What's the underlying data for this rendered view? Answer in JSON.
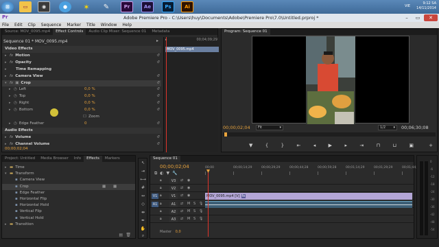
{
  "taskbar": {
    "apps": [
      "Pr",
      "Ae",
      "Ps",
      "Ai"
    ],
    "tray_lang": "VIE",
    "tray_time": "9:12 SA",
    "tray_date": "14/11/2014"
  },
  "window": {
    "title": "Adobe Premiere Pro - C:\\Users\\huy\\Documents\\Adobe\\Premiere Pro\\7.0\\Untitled.prproj *"
  },
  "menu": [
    "File",
    "Edit",
    "Clip",
    "Sequence",
    "Marker",
    "Title",
    "Window",
    "Help"
  ],
  "source_panel": {
    "tabs": [
      "Source: MOV_0095.mp4",
      "Effect Controls",
      "Audio Clip Mixer: Sequence 01",
      "Metadata"
    ],
    "clip_label": "Sequence 01 * MOV_0095.mp4",
    "ruler_time": "00;04;09;29",
    "clip_bar": "MOV_0095.mp4",
    "rows": [
      {
        "name": "Video Effects",
        "kind": "section"
      },
      {
        "name": "Motion",
        "kind": "fx"
      },
      {
        "name": "Opacity",
        "kind": "fx"
      },
      {
        "name": "Time Remapping",
        "kind": "plain"
      },
      {
        "name": "Camera View",
        "kind": "fx"
      },
      {
        "name": "Crop",
        "kind": "fx-open"
      },
      {
        "name": "Left",
        "kind": "param",
        "value": "0,0 %"
      },
      {
        "name": "Top",
        "kind": "param",
        "value": "0,0 %"
      },
      {
        "name": "Right",
        "kind": "param",
        "value": "0,0 %"
      },
      {
        "name": "Bottom",
        "kind": "param",
        "value": "0,0 %"
      },
      {
        "name": "Zoom",
        "kind": "check"
      },
      {
        "name": "Edge Feather",
        "kind": "param",
        "value": "0"
      },
      {
        "name": "Audio Effects",
        "kind": "section"
      },
      {
        "name": "Volume",
        "kind": "fx"
      },
      {
        "name": "Channel Volume",
        "kind": "fx"
      }
    ],
    "footer_time": "00;00;02;04"
  },
  "program_panel": {
    "tab": "Program: Sequence 01",
    "current_time": "00;00;02;04",
    "fit": "Fit",
    "resolution": "1/2",
    "duration": "00;06;30;08"
  },
  "effects_panel": {
    "tabs": [
      "Project: Untitled",
      "Media Browser",
      "Info",
      "Effects",
      "Markers"
    ],
    "items": [
      {
        "label": "Time",
        "level": 1,
        "type": "folder"
      },
      {
        "label": "Transform",
        "level": 1,
        "type": "folder-open"
      },
      {
        "label": "Camera View",
        "level": 2,
        "type": "fx"
      },
      {
        "label": "Crop",
        "level": 2,
        "type": "fx",
        "selected": true
      },
      {
        "label": "Edge Feather",
        "level": 2,
        "type": "fx"
      },
      {
        "label": "Horizontal Flip",
        "level": 2,
        "type": "fx"
      },
      {
        "label": "Horizontal Hold",
        "level": 2,
        "type": "fx"
      },
      {
        "label": "Vertical Flip",
        "level": 2,
        "type": "fx"
      },
      {
        "label": "Vertical Hold",
        "level": 2,
        "type": "fx"
      },
      {
        "label": "Transition",
        "level": 1,
        "type": "folder"
      }
    ]
  },
  "timeline": {
    "tab": "Sequence 01",
    "current_time": "00;00;02;04",
    "ruler": [
      "00;00",
      "00;00;14;29",
      "00;00;29;29",
      "00;00;44;28",
      "00;00;59;28",
      "00;01;14;29",
      "00;01;29;29",
      "00;01;44;28"
    ],
    "video_tracks": [
      "V3",
      "V2",
      "V1"
    ],
    "audio_tracks": [
      "A1",
      "A2",
      "A3"
    ],
    "src_patch_v": "V1",
    "src_patch_a": "A1",
    "video_clip": "MOV_0095.mp4 [V]",
    "audio_label": "Master",
    "audio_value": "0,0",
    "track_btn_m": "M",
    "track_btn_s": "S",
    "meter_ticks": [
      "0",
      "-6",
      "-12",
      "-18",
      "-24",
      "-30",
      "-36",
      "-42",
      "-48",
      "-54"
    ]
  },
  "colors": {
    "playhead": "#e0352b",
    "accent_orange": "#e8a33d",
    "accent_blue": "#5b9be0",
    "video_clip": "#b3a6d6",
    "audio_clip": "#6aa7c4"
  }
}
